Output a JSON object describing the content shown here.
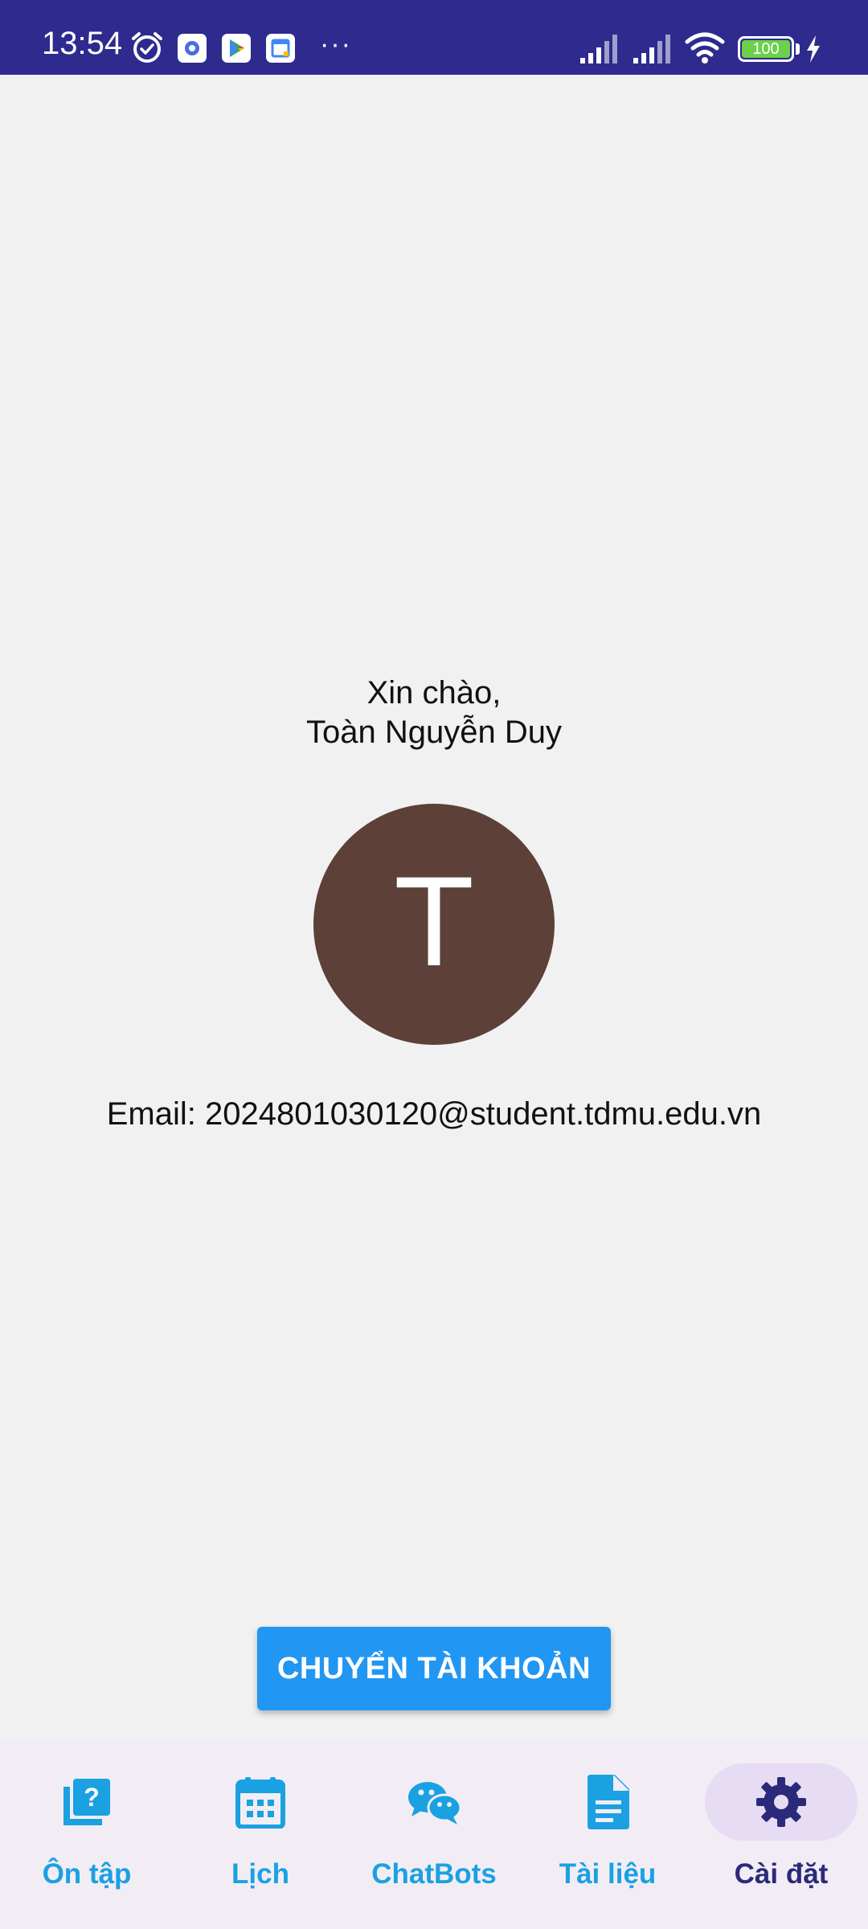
{
  "status_bar": {
    "time": "13:54",
    "more": "···",
    "battery_level": "100",
    "icons": [
      "alarm-icon",
      "settings-app-icon",
      "play-store-icon",
      "calendar-app-icon",
      "signal-icon",
      "signal-icon",
      "wifi-icon",
      "battery-icon",
      "charging-icon"
    ]
  },
  "profile": {
    "greeting_line1": "Xin chào,",
    "greeting_line2": "Toàn Nguyễn Duy",
    "avatar_letter": "T",
    "email_text": "Email: 2024801030120@student.tdmu.edu.vn"
  },
  "actions": {
    "switch_account_label": "CHUYỂN TÀI KHOẢN"
  },
  "bottom_nav": {
    "items": [
      {
        "label": "Ôn tập",
        "icon": "quiz-icon"
      },
      {
        "label": "Lịch",
        "icon": "calendar-icon"
      },
      {
        "label": "ChatBots",
        "icon": "chat-icon"
      },
      {
        "label": "Tài liệu",
        "icon": "document-icon"
      },
      {
        "label": "Cài đặt",
        "icon": "settings-icon"
      }
    ],
    "active_index": 4
  },
  "colors": {
    "status_bar": "#2e2a8e",
    "background": "#f2f1f2",
    "avatar": "#5d4037",
    "button": "#2196f3",
    "nav_item": "#1aa1e2",
    "nav_active": "#2b2a7a",
    "nav_active_pill": "#e6dcf4",
    "nav_background": "#f2edf5"
  }
}
